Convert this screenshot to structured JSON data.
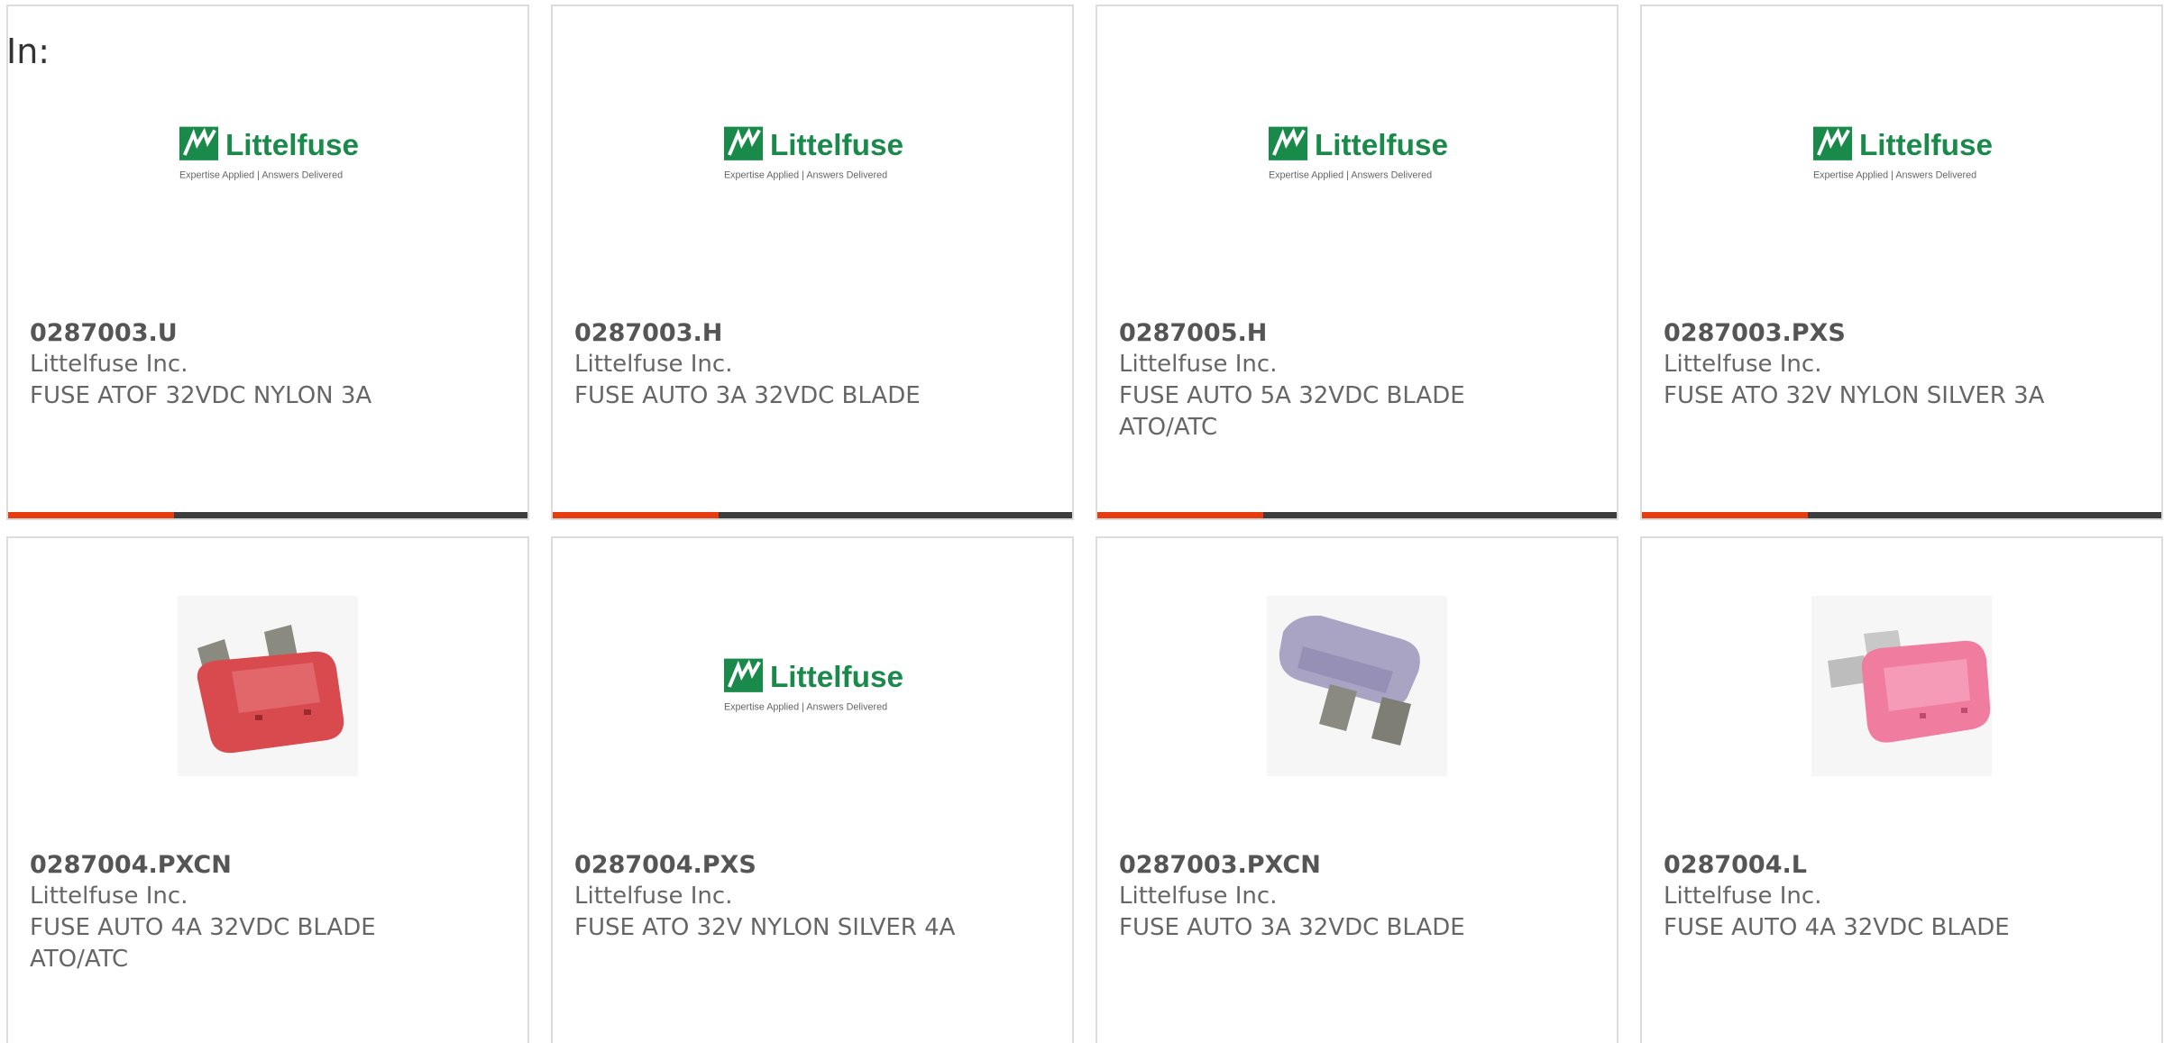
{
  "filter_label": "In:",
  "colors": {
    "accent": "#e63c0f",
    "bar_dark": "#3d3d3d",
    "logo_green": "#1a8a4a"
  },
  "logo": {
    "brand": "Littelfuse",
    "tagline": "Expertise Applied | Answers Delivered"
  },
  "products": [
    {
      "part_number": "0287003.U",
      "manufacturer": "Littelfuse Inc.",
      "description": "FUSE ATOF 32VDC NYLON 3A",
      "image": "littelfuse-logo"
    },
    {
      "part_number": "0287003.H",
      "manufacturer": "Littelfuse Inc.",
      "description": "FUSE AUTO 3A 32VDC BLADE",
      "image": "littelfuse-logo"
    },
    {
      "part_number": "0287005.H",
      "manufacturer": "Littelfuse Inc.",
      "description": "FUSE AUTO 5A 32VDC BLADE ATO/ATC",
      "image": "littelfuse-logo"
    },
    {
      "part_number": "0287003.PXS",
      "manufacturer": "Littelfuse Inc.",
      "description": "FUSE ATO 32V NYLON SILVER 3A",
      "image": "littelfuse-logo"
    },
    {
      "part_number": "0287004.PXCN",
      "manufacturer": "Littelfuse Inc.",
      "description": "FUSE AUTO 4A 32VDC BLADE ATO/ATC",
      "image": "red-blade-fuse"
    },
    {
      "part_number": "0287004.PXS",
      "manufacturer": "Littelfuse Inc.",
      "description": "FUSE ATO 32V NYLON SILVER 4A",
      "image": "littelfuse-logo"
    },
    {
      "part_number": "0287003.PXCN",
      "manufacturer": "Littelfuse Inc.",
      "description": "FUSE AUTO 3A 32VDC BLADE",
      "image": "violet-blade-fuse"
    },
    {
      "part_number": "0287004.L",
      "manufacturer": "Littelfuse Inc.",
      "description": "FUSE AUTO 4A 32VDC BLADE",
      "image": "pink-blade-fuse"
    }
  ]
}
